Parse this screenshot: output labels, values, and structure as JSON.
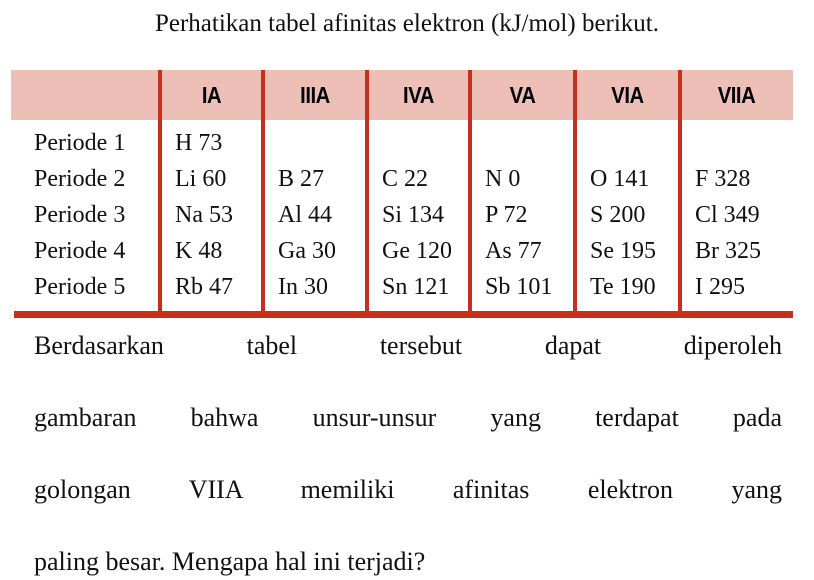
{
  "intro": {
    "title": "Perhatikan tabel afinitas elektron (kJ/mol) berikut."
  },
  "table": {
    "colors": {
      "header_background": "#eebfb7",
      "rule": "#c4301b",
      "text": "#111111"
    },
    "corner_label": "",
    "columns": [
      "IA",
      "IIIA",
      "IVA",
      "VA",
      "VIA",
      "VIIA"
    ],
    "rows": [
      {
        "label": "Periode 1",
        "cells": [
          "H 73",
          "",
          "",
          "",
          "",
          ""
        ]
      },
      {
        "label": "Periode 2",
        "cells": [
          "Li 60",
          "B 27",
          "C 22",
          "N 0",
          "O 141",
          "F 328"
        ]
      },
      {
        "label": "Periode 3",
        "cells": [
          "Na 53",
          "Al 44",
          "Si 134",
          "P 72",
          "S 200",
          "Cl 349"
        ]
      },
      {
        "label": "Periode 4",
        "cells": [
          "K 48",
          "Ga 30",
          "Ge 120",
          "As 77",
          "Se 195",
          "Br 325"
        ]
      },
      {
        "label": "Periode 5",
        "cells": [
          "Rb 47",
          "In 30",
          "Sn 121",
          "Sb 101",
          "Te 190",
          "I 295"
        ]
      }
    ]
  },
  "question": {
    "lines": [
      "Berdasarkan tabel tersebut dapat diperoleh",
      "gambaran bahwa unsur-unsur yang terdapat pada",
      "golongan VIIA memiliki afinitas elektron yang",
      "paling besar. Mengapa hal ini terjadi?"
    ]
  }
}
